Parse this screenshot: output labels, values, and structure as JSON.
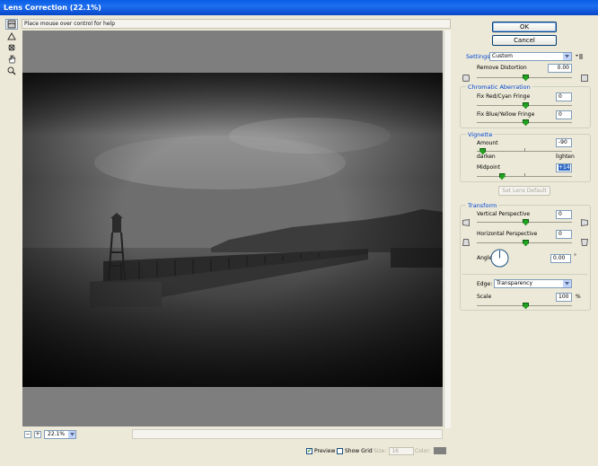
{
  "window": {
    "title": "Lens Correction (22.1%)"
  },
  "help_text": "Place mouse over control for help",
  "tools": [
    "remove-distortion-tool",
    "straighten-tool",
    "move-grid-tool",
    "hand-tool",
    "zoom-tool"
  ],
  "zoom": {
    "value": "22.1%"
  },
  "buttons": {
    "ok": "OK",
    "cancel": "Cancel",
    "set_lens_default": "Set Lens Default"
  },
  "settings": {
    "label": "Settings:",
    "value": "Custom"
  },
  "remove_distortion": {
    "label": "Remove Distortion",
    "value": "0.00",
    "level": 0.5
  },
  "chromatic": {
    "title": "Chromatic Aberration",
    "red_cyan": {
      "label": "Fix Red/Cyan Fringe",
      "value": "0",
      "level": 0.5
    },
    "blue_yellow": {
      "label": "Fix Blue/Yellow Fringe",
      "value": "0",
      "level": 0.5
    }
  },
  "vignette": {
    "title": "Vignette",
    "amount": {
      "label": "Amount",
      "value": "-90",
      "level": 0.05
    },
    "darken": "darken",
    "lighten": "lighten",
    "midpoint": {
      "label": "Midpoint",
      "value": "+14",
      "level": 0.25
    }
  },
  "transform": {
    "title": "Transform",
    "vertical": {
      "label": "Vertical Perspective",
      "value": "0",
      "level": 0.5
    },
    "horizontal": {
      "label": "Horizontal Perspective",
      "value": "0",
      "level": 0.5
    },
    "angle": {
      "label": "Angle:",
      "value": "0.00",
      "unit": "°"
    },
    "edge": {
      "label": "Edge:",
      "value": "Transparency"
    },
    "scale": {
      "label": "Scale",
      "value": "100",
      "unit": "%",
      "level": 0.5
    }
  },
  "bottom": {
    "preview": "Preview",
    "show_grid": "Show Grid",
    "size_label": "Size:",
    "size_value": "16",
    "color_label": "Color:"
  },
  "colors": {
    "title_bar": "#0a5ee6",
    "accent": "#0046d5",
    "slider_thumb": "#21a121"
  }
}
